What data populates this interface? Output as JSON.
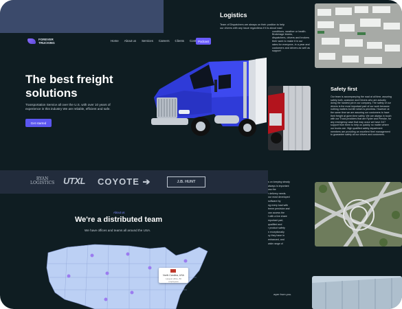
{
  "logo": {
    "line1": "FOREVER",
    "line2": "TRUCKING"
  },
  "nav": {
    "items": [
      "Home",
      "About us",
      "Services",
      "Careers",
      "Clients",
      "Contacts"
    ],
    "cta": "Podcast"
  },
  "hero": {
    "title": "The best freight solutions",
    "description": "Transportation Service all over the U.S. with over 10 years of experience in this industry We are reliable, efficient and safe.",
    "button": "Get started"
  },
  "partners": {
    "ryan_line1": "RYAN",
    "ryan_line2": "LOGISTICS",
    "utxl": "UTXL",
    "coyote": "COYOTE",
    "jbhunt": "J.B. HUNT"
  },
  "team": {
    "tag": "About us",
    "title": "We're a distributed team",
    "subtitle": "We have offices and teams all around the USA.",
    "tooltip_city": "North Carolina, USA",
    "tooltip_detail": "Largest office, 80 employees"
  },
  "logistics": {
    "title": "Logistics",
    "lines": [
      "Team of Dispatchers are always on their position to help",
      "our drivers with any issue regardless if it is about road",
      "conditions, weather or health. Brokerage teams,",
      "dispatchers, drivers and brokers",
      "their work to make it in our",
      "rates for everyone, in a year and",
      "customers and drivers as well as support"
    ]
  },
  "safety": {
    "title": "Safety first",
    "lines": [
      "Our team is accompanying the road at all time, assuring",
      "safety both, customer and Drivers who are actually",
      "doing the hardest job in our company. The safety of our",
      "drivers is the most important part of our work because",
      "nothing matters but life which is priceless. However at",
      "the same time we are assuring our customers to have",
      "their freight at given time safely. We are always in touch",
      "with our Truck providers that are Ryder and Penske, for",
      "any emergency case that may occur we have 24/7",
      "support from them to help us quickly no matter where",
      "our trucks are. High qualified safety department",
      "members are providing an excellent fleet management",
      "to guarantee safety all our drivers and customers."
    ]
  },
  "technology": {
    "lines": [
      "s on keeping steady",
      "always is important",
      "oss the",
      "r delivery needs.",
      "our most developed",
      "software by",
      "ng every load with",
      "treme precision and",
      "can access the",
      "t with a live share",
      "mportant part,",
      "qualified and",
      "r product safety",
      "n exceptionally",
      "cy they have in",
      "enhanced, and",
      "wide range of"
    ],
    "footer": "wyer from you."
  },
  "colors": {
    "background": "#0f1d22",
    "accent": "#5b56f0",
    "partner_band": "#222c3c",
    "map_fill": "#bcd0f4"
  }
}
